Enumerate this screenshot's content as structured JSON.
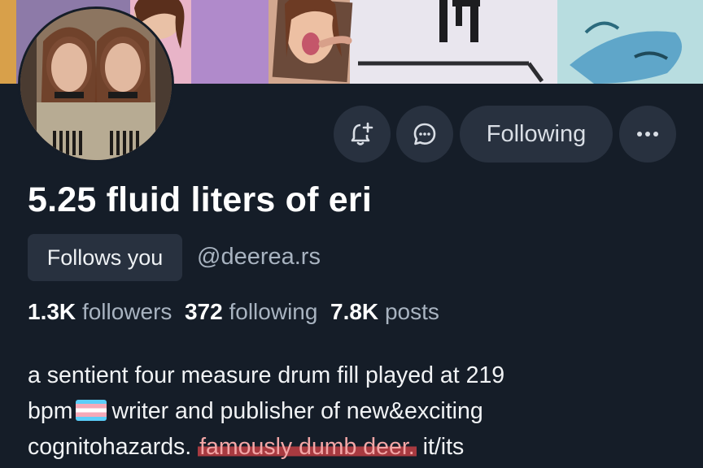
{
  "profile": {
    "display_name": "5.25 fluid liters of eri",
    "badge": "Follows you",
    "handle": "@deerea.rs",
    "follow_button": "Following"
  },
  "icons": {
    "subscribe": "bell-plus-icon",
    "message": "chat-bubble-icon",
    "more": "ellipsis-icon"
  },
  "stats": {
    "followers_count": "1.3K",
    "followers_label": "followers",
    "following_count": "372",
    "following_label": "following",
    "posts_count": "7.8K",
    "posts_label": "posts"
  },
  "bio": {
    "line1": "a sentient four measure drum fill played at 219",
    "line2_a": "bpm",
    "line2_b": "writer and publisher of new&exciting",
    "line3_a": "cognitohazards.",
    "line3_highlight": "famously dumb deer.",
    "line3_b": "it/its"
  },
  "colors": {
    "background": "#151d28",
    "button_bg": "#28313f",
    "muted_text": "#a8b3c0",
    "highlight": "#a83a40"
  }
}
